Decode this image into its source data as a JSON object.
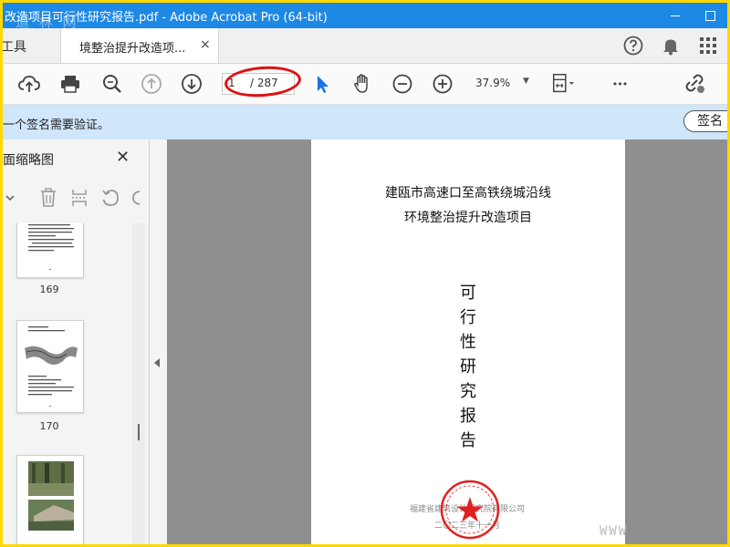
{
  "window": {
    "title": "改造项目可行性研究报告.pdf - Adobe Acrobat Pro (64-bit)",
    "watermark": "道 林 网"
  },
  "tabs": {
    "tools_label": "工具",
    "document_label": "境整治提升改造项...",
    "close_glyph": "×"
  },
  "toolbar": {
    "current_page": "1",
    "total_pages": "/ 287",
    "zoom": "37.9%",
    "zoom_dropdown": "▼",
    "more_glyph": "•••"
  },
  "notice": {
    "message": "一个签名需要验证。",
    "sign_button": "签名"
  },
  "panel": {
    "title": "面缩略图",
    "close_glyph": "✕",
    "thumbnails": [
      {
        "number": "169"
      },
      {
        "number": "170"
      }
    ]
  },
  "document": {
    "title_line1": "建瓯市高速口至高铁绕城沿线",
    "title_line2": "环境整治提升改造项目",
    "vertical_title": [
      "可",
      "行",
      "性",
      "研",
      "究",
      "报",
      "告"
    ],
    "organization": "福建省建筑设计研究院有限公司",
    "date": "二〇二三年十一月",
    "watermark": "WWW"
  },
  "colors": {
    "titlebar": "#1e88e5",
    "notice_bar": "#cfe6fb",
    "annotation_oval": "#e01010",
    "seal": "#e02020",
    "frame_border": "#ffd800"
  },
  "icons": {
    "upload": "cloud-upload-icon",
    "print": "printer-icon",
    "search": "magnifier-icon",
    "prev_page": "arrow-up-circle-icon",
    "next_page": "arrow-down-circle-icon",
    "select": "cursor-arrow-icon",
    "hand": "hand-icon",
    "zoom_out": "minus-circle-icon",
    "zoom_in": "plus-circle-icon",
    "fit": "fit-page-icon",
    "share": "link-icon",
    "help": "question-icon",
    "notifications": "bell-icon",
    "apps": "grid-icon"
  }
}
